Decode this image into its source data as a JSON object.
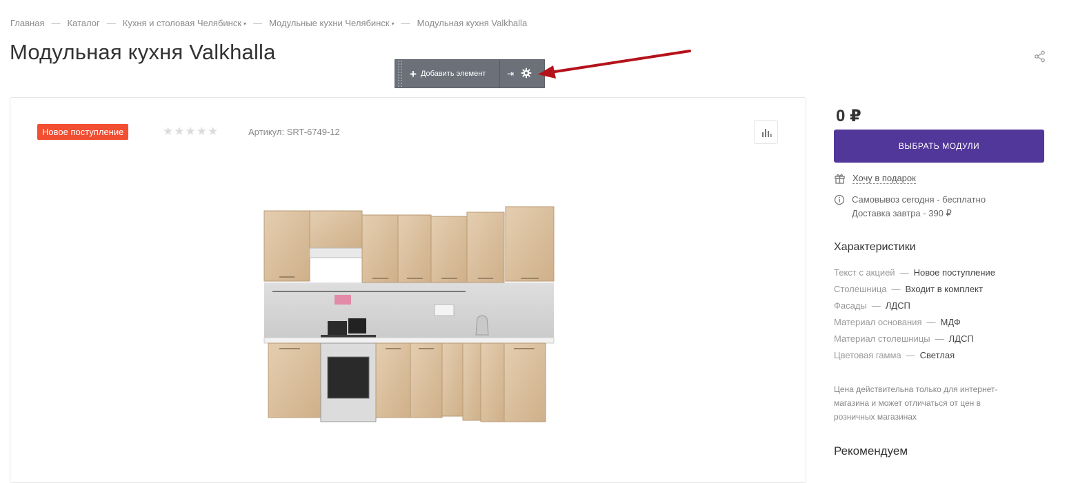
{
  "breadcrumb": {
    "items": [
      "Главная",
      "Каталог",
      "Кухня и столовая Челябинск",
      "Модульные кухни Челябинск",
      "Модульная кухня Valkhalla"
    ],
    "separator": "—",
    "dropdown_caret": "▾"
  },
  "page": {
    "title": "Модульная кухня Valkhalla"
  },
  "admin_toolbar": {
    "add_label": "Добавить элемент",
    "plus": "+",
    "pin_glyph": "⇥"
  },
  "product": {
    "badge": "Новое поступление",
    "stars": "★★★★★",
    "rating_value": 0,
    "sku": "Артикул: SRT-6749-12"
  },
  "buy": {
    "price": "0 ₽",
    "choose_modules": "ВЫБРАТЬ МОДУЛИ",
    "gift_link": "Хочу в подарок",
    "pickup": "Самовывоз сегодня - бесплатно",
    "delivery": "Доставка завтра - 390 ₽"
  },
  "characteristics": {
    "title": "Характеристики",
    "separator": "—",
    "items": [
      {
        "key": "Текст с акцией",
        "value": "Новое поступление"
      },
      {
        "key": "Столешница",
        "value": "Входит в комплект"
      },
      {
        "key": "Фасады",
        "value": "ЛДСП"
      },
      {
        "key": "Материал основания",
        "value": "МДФ"
      },
      {
        "key": "Материал столешницы",
        "value": "ЛДСП"
      },
      {
        "key": "Цветовая гамма",
        "value": "Светлая"
      }
    ]
  },
  "price_note": "Цена действительна только для интернет-магазина и может отличаться от цен в розничных магазинах",
  "recommend": {
    "title": "Рекомендуем"
  },
  "colors": {
    "accent": "#52379a",
    "badge": "#f24e32",
    "arrow": "#b5121b",
    "toolbar": "#6b7079"
  },
  "icons": [
    "share-icon",
    "plus-icon",
    "pin-icon",
    "gear-icon",
    "chart-icon",
    "gift-icon",
    "info-icon",
    "star-icon"
  ]
}
